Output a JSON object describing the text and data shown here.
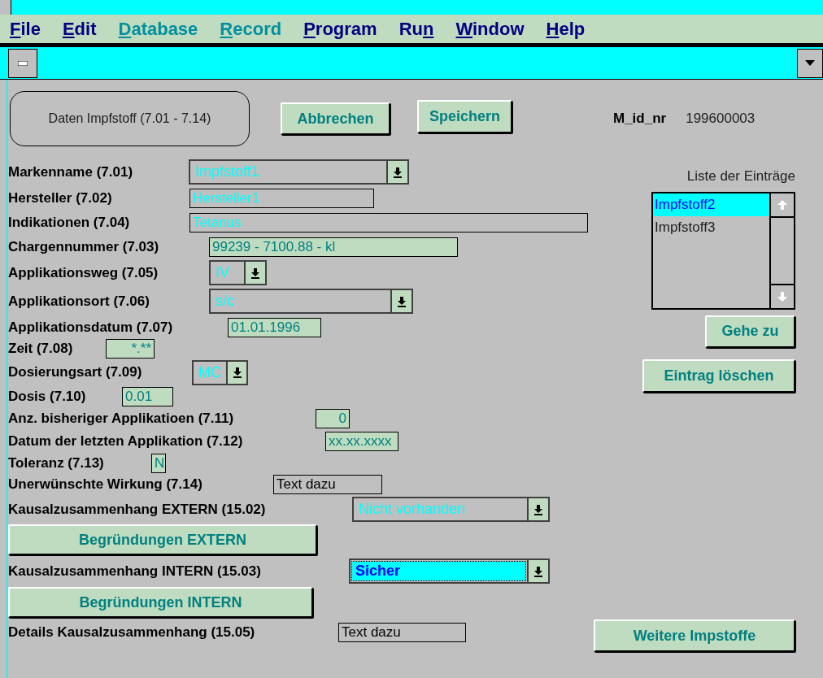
{
  "menu": [
    {
      "key": "F",
      "post": "ile",
      "disabled": false
    },
    {
      "key": "E",
      "post": "dit",
      "disabled": false
    },
    {
      "key": "D",
      "post": "atabase",
      "disabled": true
    },
    {
      "key": "R",
      "post": "ecord",
      "disabled": true
    },
    {
      "key": "P",
      "post": "rogram",
      "disabled": false
    },
    {
      "pre": "Ru",
      "key": "n",
      "disabled": false
    },
    {
      "key": "W",
      "post": "indow",
      "disabled": false
    },
    {
      "key": "H",
      "post": "elp",
      "disabled": false
    }
  ],
  "form_title": "Daten Impfstoff (7.01 - 7.14)",
  "buttons": [
    "Abbrechen",
    "Speichern"
  ],
  "id_label": "M_id_nr",
  "id_value": "199600003",
  "fields": [
    {
      "label": "Markenname (7.01)",
      "kind": "combo",
      "focused": false,
      "value": "Impfstoff1"
    },
    {
      "label": "Hersteller (7.02)",
      "kind": "text",
      "focused": false,
      "value": "Hersteller1"
    },
    {
      "label": "Indikationen (7.04)",
      "kind": "text",
      "focused": false,
      "value": "Tetanus"
    },
    {
      "label": "Chargennummer (7.03)",
      "kind": "text",
      "focused": false,
      "value": "99239 - 7100.88 - kl"
    },
    {
      "label": "Applikationsweg (7.05)",
      "kind": "combo",
      "focused": false,
      "value": "IV"
    },
    {
      "label": "Applikationsort (7.06)",
      "kind": "combo",
      "focused": false,
      "value": "s/c"
    },
    {
      "label": "Applikationsdatum (7.07)",
      "kind": "text",
      "focused": false,
      "value": "01.01.1996"
    },
    {
      "label": "Zeit (7.08)",
      "kind": "text",
      "focused": false,
      "value": "*.**"
    },
    {
      "label": "Dosierungsart (7.09)",
      "kind": "combo",
      "focused": false,
      "value": "MC"
    },
    {
      "label": "Dosis (7.10)",
      "kind": "text",
      "focused": false,
      "value": "0.01"
    },
    {
      "label": "Anz. bisheriger Applikatioen (7.11)",
      "kind": "text",
      "focused": false,
      "value": "0"
    },
    {
      "label": "Datum der letzten Applikation (7.12)",
      "kind": "text",
      "focused": false,
      "value": "xx.xx.xxxx"
    },
    {
      "label": "Toleranz (7.13)",
      "kind": "text",
      "focused": false,
      "value": "N"
    },
    {
      "label": "Unerwünschte Wirkung (7.14)",
      "kind": "text",
      "focused": false,
      "value": "Text dazu"
    },
    {
      "label": "Kausalzusammenhang EXTERN (15.02)",
      "kind": "combo",
      "focused": false,
      "value": "Nicht vorhanden"
    },
    {
      "label": "Begründungen EXTERN",
      "kind": "button"
    },
    {
      "label": "Kausalzusammenhang INTERN (15.03)",
      "kind": "combo",
      "focused": true,
      "value": "Sicher"
    },
    {
      "label": "Begründungen INTERN",
      "kind": "button"
    },
    {
      "label": "Details Kausalzusammenhang (15.05)",
      "kind": "text",
      "focused": false,
      "value": "Text dazu"
    }
  ],
  "list": {
    "title": "Liste der Einträge",
    "items": [
      {
        "label": "Impfstoff2",
        "selected": true
      },
      {
        "label": "Impfstoff3",
        "selected": false
      }
    ]
  },
  "list_buttons": [
    "Gehe zu",
    "Eintrag löschen"
  ],
  "more_button": "Weitere Impstoffe"
}
